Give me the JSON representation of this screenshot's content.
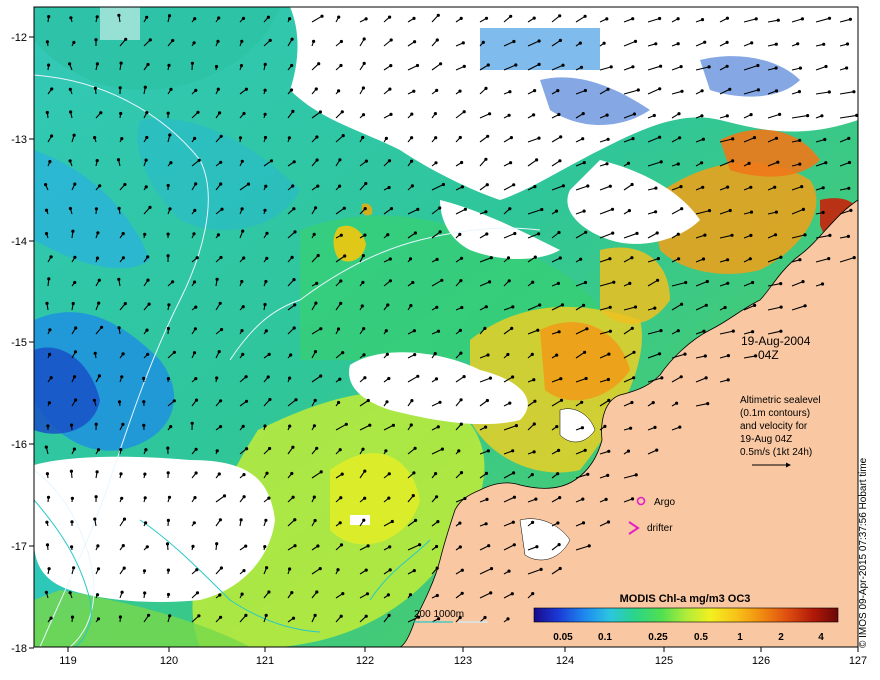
{
  "map": {
    "date_line": "19-Aug-2004",
    "time_line": "04Z",
    "info_lines": [
      "Altimetric sealevel",
      "(0.1m contours)",
      "and velocity for",
      "19-Aug 04Z",
      "0.5m/s (1kt 24h)"
    ],
    "legend_argo": "Argo",
    "legend_drifter": "drifter",
    "contour_depth_label": "200  1000m",
    "credit": "© IMOS 09-Apr-2015 07:37:56 Hobart time",
    "colors": {
      "land": "#f9c7a1",
      "cloud": "#ffffff",
      "argo": "#e020c8",
      "drifter": "#e020c8",
      "contour_200": "#28c8c8",
      "contour_1000": "#d0f0ff"
    }
  },
  "axes": {
    "x_ticks": [
      "119",
      "120",
      "121",
      "122",
      "123",
      "124",
      "125",
      "126",
      "127"
    ],
    "y_ticks": [
      "-12",
      "-13",
      "-14",
      "-15",
      "-16",
      "-17",
      "-18"
    ]
  },
  "colorbar": {
    "title": "MODIS Chl-a mg/m3 OC3",
    "ticks": [
      "0.05",
      "0.1",
      "0.25",
      "0.5",
      "1",
      "2",
      "4"
    ],
    "colors": [
      "#1a0a8a",
      "#1b3ad6",
      "#1f8bf0",
      "#2bc6e0",
      "#2ad48a",
      "#50e050",
      "#b0ec3a",
      "#f2f020",
      "#f8c018",
      "#f08a10",
      "#e05010",
      "#b01808",
      "#6a0808"
    ]
  }
}
